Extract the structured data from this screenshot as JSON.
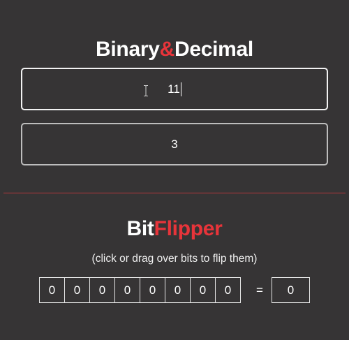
{
  "converter": {
    "title_part1": "Binary",
    "title_amp": "&",
    "title_part2": "Decimal",
    "binary_value": "11",
    "decimal_value": "3"
  },
  "flipper": {
    "title_part1": "Bit",
    "title_part2": "Flipper",
    "hint": "(click or drag over bits to flip them)",
    "bits": [
      "0",
      "0",
      "0",
      "0",
      "0",
      "0",
      "0",
      "0"
    ],
    "equals": "=",
    "result": "0"
  },
  "colors": {
    "background": "#363435",
    "accent": "#e8343a",
    "text": "#ffffff"
  }
}
